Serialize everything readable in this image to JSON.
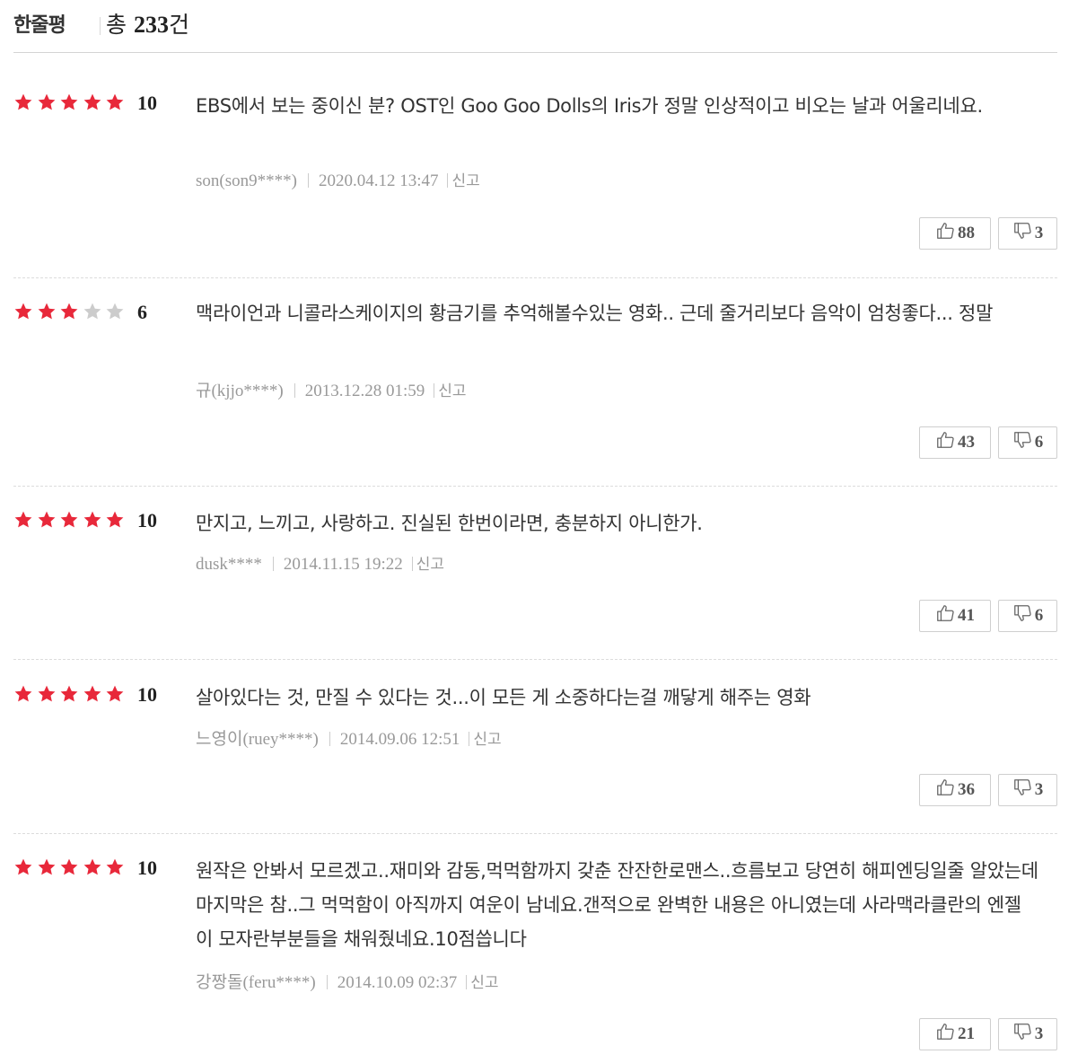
{
  "header": {
    "section_title": "한줄평",
    "total_prefix": "총 ",
    "total_count": "233",
    "total_suffix": "건"
  },
  "colors": {
    "star_on": "#e8283a",
    "star_off": "#cccccc"
  },
  "icons": {
    "like": "thumbs-up-icon",
    "dislike": "thumbs-down-icon",
    "star": "star-icon"
  },
  "reviews": [
    {
      "score": "10",
      "stars_filled": 5,
      "text": "EBS에서 보는 중이신 분? OST인 Goo Goo Dolls의 Iris가 정말 인상적이고 비오는 날과 어울리네요.",
      "author": "son(son9****)",
      "datetime": "2020.04.12 13:47",
      "report": "신고",
      "likes": "88",
      "dislikes": "3"
    },
    {
      "score": "6",
      "stars_filled": 3,
      "text": "맥라이언과 니콜라스케이지의 황금기를 추억해볼수있는 영화.. 근데 줄거리보다 음악이 엄청좋다... 정말",
      "author": "규(kjjo****)",
      "datetime": "2013.12.28 01:59",
      "report": "신고",
      "likes": "43",
      "dislikes": "6"
    },
    {
      "score": "10",
      "stars_filled": 5,
      "text": "만지고, 느끼고, 사랑하고. 진실된 한번이라면, 충분하지 아니한가.",
      "author": "dusk****",
      "datetime": "2014.11.15 19:22",
      "report": "신고",
      "likes": "41",
      "dislikes": "6"
    },
    {
      "score": "10",
      "stars_filled": 5,
      "text": "살아있다는 것, 만질 수 있다는 것...이 모든 게 소중하다는걸 깨닿게 해주는 영화",
      "author": "느영이(ruey****)",
      "datetime": "2014.09.06 12:51",
      "report": "신고",
      "likes": "36",
      "dislikes": "3"
    },
    {
      "score": "10",
      "stars_filled": 5,
      "text": "원작은 안봐서 모르겠고..재미와 감동,먹먹함까지 갖춘 잔잔한로맨스..흐름보고 당연히 해피엔딩일줄 알았는데 마지막은 참..그 먹먹함이 아직까지 여운이 남네요.갠적으로 완벽한 내용은 아니였는데 사라맥라클란의 엔젤 이 모자란부분들을 채워줬네요.10점씁니다",
      "author": "강짱돌(feru****)",
      "datetime": "2014.10.09 02:37",
      "report": "신고",
      "likes": "21",
      "dislikes": "3"
    }
  ]
}
